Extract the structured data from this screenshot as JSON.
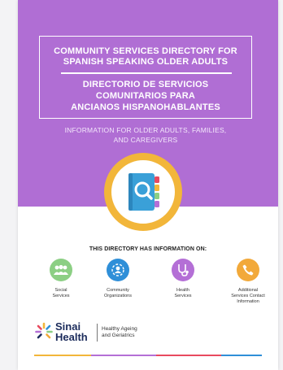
{
  "cover": {
    "title_en_line1": "COMMUNITY SERVICES DIRECTORY FOR",
    "title_en_line2": "SPANISH SPEAKING OLDER ADULTS",
    "title_es_line1": "DIRECTORIO DE SERVICIOS",
    "title_es_line2": "COMUNITARIOS PARA",
    "title_es_line3": "ANCIANOS HISPANOHABLANTES",
    "subtitle_line1": "INFORMATION FOR OLDER ADULTS, FAMILIES,",
    "subtitle_line2": "AND CAREGIVERS"
  },
  "directory": {
    "heading": "THIS DIRECTORY HAS INFORMATION ON:",
    "features": [
      {
        "line1": "Social",
        "line2": "Services",
        "line3": "",
        "icon": "people-icon",
        "color": "#8ccf84"
      },
      {
        "line1": "Community",
        "line2": "Organizations",
        "line3": "",
        "icon": "community-icon",
        "color": "#2f8fd8"
      },
      {
        "line1": "Health",
        "line2": "Services",
        "line3": "",
        "icon": "stethoscope-icon",
        "color": "#b46fd6"
      },
      {
        "line1": "Additional",
        "line2": "Services Contact",
        "line3": "Information",
        "icon": "phone-icon",
        "color": "#f2a93a"
      }
    ]
  },
  "logo": {
    "word1": "Sinai",
    "word2": "Health",
    "tag_line1": "Healthy Ageing",
    "tag_line2": "and Geriatrics"
  },
  "colors": {
    "hero": "#b06ed4",
    "ring": "#f2b63a",
    "book": "#3aa0d8"
  }
}
